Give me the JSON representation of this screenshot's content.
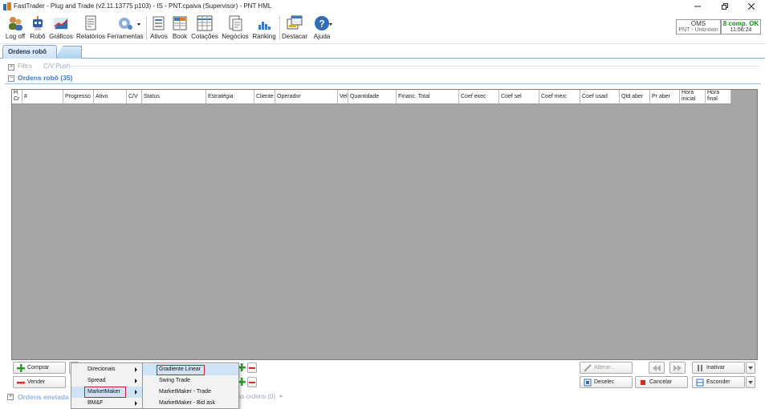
{
  "window": {
    "title": "FastTrader - Plug and Trade (v2.11.13775 p103) - IS - PNT.cpaiva (Supervisor) - PNT HML"
  },
  "toolbar": {
    "items": [
      {
        "label": "Log off",
        "icon": "logoff-users-icon"
      },
      {
        "label": "Robô",
        "icon": "robot-icon"
      },
      {
        "label": "Gráficos",
        "icon": "charts-icon"
      },
      {
        "label": "Relatórios",
        "icon": "reports-icon"
      },
      {
        "label": "Ferramentas",
        "icon": "tools-gear-icon"
      },
      {
        "label": "Ativos",
        "icon": "assets-icon"
      },
      {
        "label": "Book",
        "icon": "book-icon"
      },
      {
        "label": "Cotações",
        "icon": "quotes-grid-icon"
      },
      {
        "label": "Negócios",
        "icon": "trades-icon"
      },
      {
        "label": "Ranking",
        "icon": "ranking-bars-icon"
      },
      {
        "label": "Destacar",
        "icon": "detach-icon"
      },
      {
        "label": "Ajuda",
        "icon": "help-icon"
      }
    ]
  },
  "status": {
    "oms_label": "OMS",
    "oms_value": "PNT - Unknown",
    "comp_label": "8 comp. OK",
    "time": "11:56:24"
  },
  "tabs": {
    "active": "Ordens robô"
  },
  "sections": {
    "filter_label": "Filtro",
    "filter_value": "C/V:Push",
    "orders_label": "Ordens robô (35)",
    "sent_label": "Ordens enviada",
    "sent_suffix": "as ordens (0)"
  },
  "grid": {
    "columns": [
      "H Cr",
      "#",
      "Progresso",
      "Ativo",
      "C/V",
      "Status",
      "Estratégia",
      "Cliente",
      "Operador",
      "Vel",
      "Quantidade",
      "Financ. Total",
      "Coef exec",
      "Coef sel",
      "Coef merc",
      "Coef usad",
      "Qtd aber",
      "Pr aber",
      "Hora inicial",
      "Hora final"
    ]
  },
  "buttons": {
    "comprar": "Comprar",
    "vender": "Vender",
    "alterar": "Alterar...",
    "inativar": "Inativar",
    "deselec": "Deselec",
    "cancelar": "Cancelar",
    "esconder": "Esconder"
  },
  "menu_main": {
    "items": [
      "Direcionais",
      "Spread",
      "MarketMaker",
      "BM&F"
    ]
  },
  "menu_sub": {
    "items": [
      "Gradiente Linear",
      "Swing Trade",
      "MarketMaker - Trade",
      "MarketMaker - Bid ask"
    ]
  },
  "colors": {
    "grid_bg": "#a6a6a6",
    "section_title": "#3b78c2",
    "highlight_box": "#c0202a",
    "status_ok": "#1a8a1a"
  }
}
